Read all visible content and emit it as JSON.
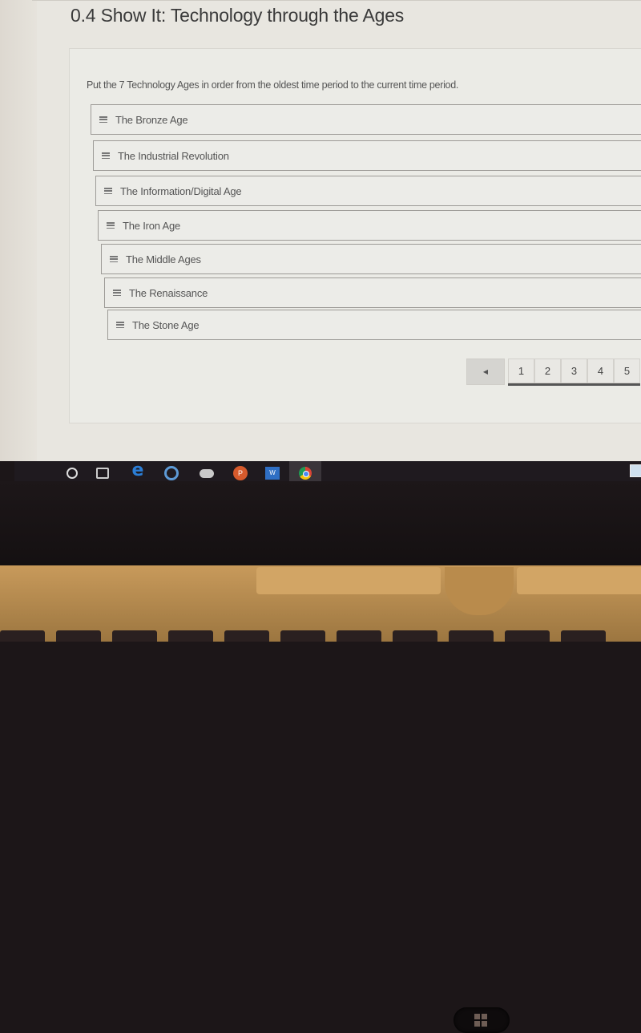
{
  "page": {
    "title": "0.4 Show It: Technology through the Ages"
  },
  "question": {
    "instructions": "Put the 7 Technology Ages in order from the oldest time period to the current time period.",
    "items": [
      {
        "label": "The Bronze Age",
        "handle_icon": "drag-handle-icon"
      },
      {
        "label": "The Industrial Revolution",
        "handle_icon": "drag-handle-icon"
      },
      {
        "label": "The Information/Digital Age",
        "handle_icon": "drag-handle-icon"
      },
      {
        "label": "The Iron Age",
        "handle_icon": "drag-handle-icon"
      },
      {
        "label": "The Middle Ages",
        "handle_icon": "drag-handle-icon"
      },
      {
        "label": "The Renaissance",
        "handle_icon": "drag-handle-icon"
      },
      {
        "label": "The Stone Age",
        "handle_icon": "drag-handle-icon"
      }
    ]
  },
  "pagination": {
    "prev_icon": "◀",
    "pages": [
      "1",
      "2",
      "3",
      "4",
      "5"
    ]
  },
  "taskbar": {
    "items": [
      {
        "name": "start",
        "icon": "windows-logo-icon"
      },
      {
        "name": "search",
        "icon": "cortana-search-icon"
      },
      {
        "name": "task-view",
        "icon": "task-view-icon"
      },
      {
        "name": "edge",
        "icon": "edge-icon",
        "glyph": "e",
        "running": true
      },
      {
        "name": "app",
        "icon": "circle-app-icon"
      },
      {
        "name": "cloud",
        "icon": "cloud-app-icon"
      },
      {
        "name": "powerpoint",
        "icon": "powerpoint-icon",
        "glyph": "P",
        "running": true
      },
      {
        "name": "word",
        "icon": "word-icon",
        "glyph": "W",
        "running": true
      },
      {
        "name": "chrome",
        "icon": "chrome-icon",
        "running": true,
        "active": true
      }
    ]
  }
}
